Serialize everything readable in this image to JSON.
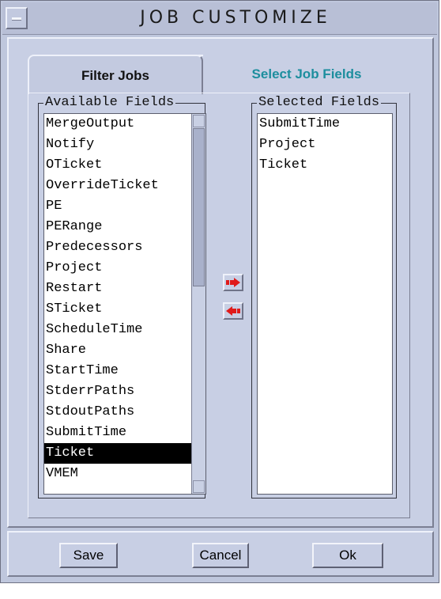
{
  "window": {
    "title": "JOB CUSTOMIZE"
  },
  "tabs": {
    "filter_jobs": "Filter Jobs",
    "select_job_fields": "Select Job Fields"
  },
  "available": {
    "label": "Available Fields",
    "items": [
      "MergeOutput",
      "Notify",
      "OTicket",
      "OverrideTicket",
      "PE",
      "PERange",
      "Predecessors",
      "Project",
      "Restart",
      "STicket",
      "ScheduleTime",
      "Share",
      "StartTime",
      "StderrPaths",
      "StdoutPaths",
      "SubmitTime",
      "Ticket",
      "VMEM"
    ],
    "selected_item": "Ticket"
  },
  "selected": {
    "label": "Selected Fields",
    "items": [
      "SubmitTime",
      "Project",
      "Ticket"
    ]
  },
  "buttons": {
    "save": "Save",
    "cancel": "Cancel",
    "ok": "Ok"
  },
  "colors": {
    "accent_tab": "#1d8e9e",
    "arrow_red": "#e01a1a",
    "window_bg": "#bfc7dd"
  },
  "icons": {
    "add": "arrow-right-icon",
    "remove": "arrow-left-icon"
  }
}
